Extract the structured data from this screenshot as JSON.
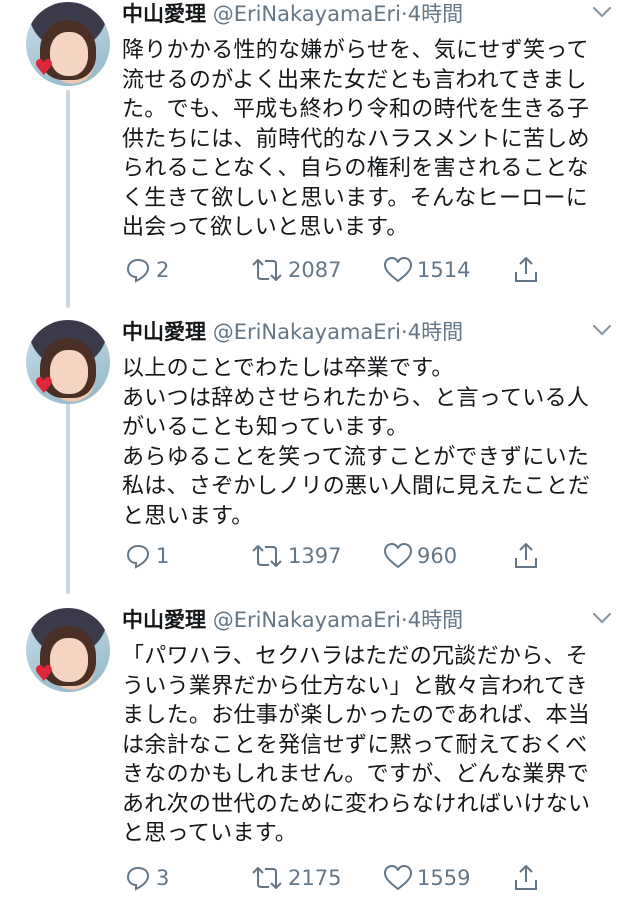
{
  "tweets": [
    {
      "name": "中山愛理",
      "handle": "@EriNakayamaEri",
      "sep": "·",
      "time": "4時間",
      "lines": [
        "降りかかる性的な嫌がらせを、気にせず笑って",
        "流せるのがよく出来た女だとも言われてきまし",
        "た。でも、平成も終わり令和の時代を生きる子",
        "供たちには、前時代的なハラスメントに苦しめ",
        "られることなく、自らの権利を害されることな",
        "く生きて欲しいと思います。そんなヒーローに",
        "出会って欲しいと思います。"
      ],
      "replies": "2",
      "retweets": "2087",
      "likes": "1514"
    },
    {
      "name": "中山愛理",
      "handle": "@EriNakayamaEri",
      "sep": "·",
      "time": "4時間",
      "lines": [
        "以上のことでわたしは卒業です。",
        "あいつは辞めさせられたから、と言っている人",
        "がいることも知っています。",
        "あらゆることを笑って流すことができずにいた",
        "私は、さぞかしノリの悪い人間に見えたことだ",
        "と思います。"
      ],
      "replies": "1",
      "retweets": "1397",
      "likes": "960"
    },
    {
      "name": "中山愛理",
      "handle": "@EriNakayamaEri",
      "sep": "·",
      "time": "4時間",
      "lines": [
        "「パワハラ、セクハラはただの冗談だから、そ",
        "ういう業界だから仕方ない」と散々言われてき",
        "ました。お仕事が楽しかったのであれば、本当",
        "は余計なことを発信せずに黙って耐えておくべ",
        "きなのかもしれません。ですが、どんな業界で",
        "あれ次の世代のために変わらなければいけない",
        "と思っています。"
      ],
      "replies": "3",
      "retweets": "2175",
      "likes": "1559"
    }
  ],
  "icons": {
    "more": "chevron-down-icon",
    "reply": "reply-icon",
    "retweet": "retweet-icon",
    "like": "heart-icon",
    "share": "share-icon"
  },
  "colors": {
    "text": "#14171a",
    "secondary": "#657786",
    "thread_line": "#ccd6dd"
  }
}
